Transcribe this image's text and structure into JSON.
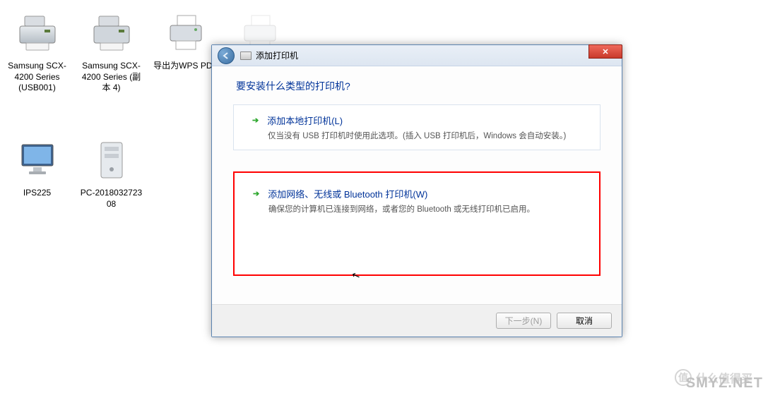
{
  "desktop": {
    "icons_row1": [
      {
        "label": "Samsung SCX-4200 Series (USB001)",
        "type": "printer"
      },
      {
        "label": "Samsung SCX-4200 Series (副本 4)",
        "type": "printer"
      },
      {
        "label": "导出为WPS PDF",
        "type": "printer-pdf"
      },
      {
        "label": "",
        "type": "printer-faded"
      }
    ],
    "icons_row2": [
      {
        "label": "IPS225",
        "type": "monitor"
      },
      {
        "label": "PC-2018032723 08",
        "type": "computer"
      }
    ]
  },
  "dialog": {
    "title": "添加打印机",
    "heading": "要安装什么类型的打印机?",
    "options": [
      {
        "title": "添加本地打印机(L)",
        "desc": "仅当没有 USB 打印机时使用此选项。(插入 USB 打印机后，Windows 会自动安装。)",
        "highlighted": false
      },
      {
        "title": "添加网络、无线或 Bluetooth 打印机(W)",
        "desc": "确保您的计算机已连接到网络，或者您的 Bluetooth 或无线打印机已启用。",
        "highlighted": true
      }
    ],
    "buttons": {
      "next": "下一步(N)",
      "cancel": "取消"
    }
  },
  "watermark": {
    "badge": "值",
    "text": "什么值得买",
    "brand": "SMYZ.NET"
  }
}
